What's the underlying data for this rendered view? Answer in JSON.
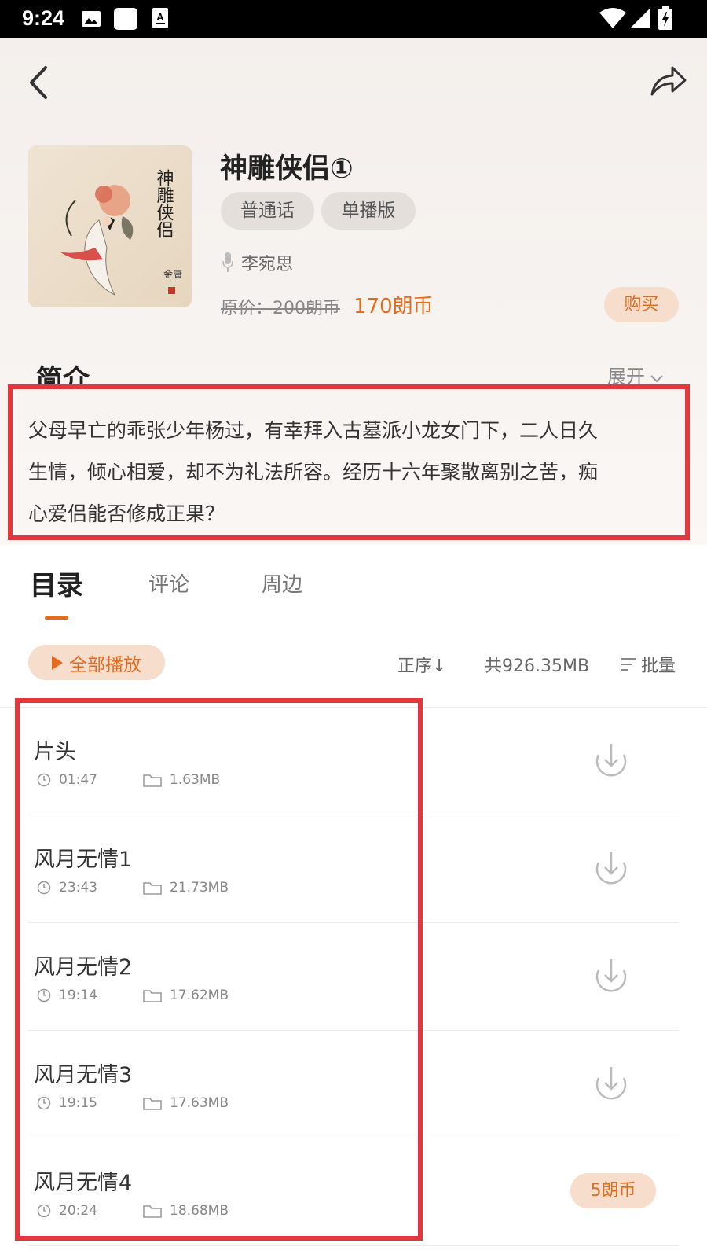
{
  "status_bar": {
    "time": "9:24",
    "left_icons": [
      "image-icon",
      "blank-notification-icon",
      "text-a-icon"
    ],
    "right_icons": [
      "wifi-icon",
      "signal-icon",
      "battery-icon"
    ]
  },
  "header": {
    "back_icon": "chevron-left-icon",
    "share_icon": "share-icon"
  },
  "book": {
    "cover_calligraphy": "神雕侠侣",
    "title": "神雕侠侣①",
    "tags": [
      "普通话",
      "单播版"
    ],
    "narrator": "李宛思",
    "price_original": "原价：200朗币",
    "price_current": "170朗币",
    "buy_label": "购买"
  },
  "intro": {
    "heading": "简介",
    "expand_label": "展开",
    "lines": [
      "父母早亡的乖张少年杨过，有幸拜入古墓派小龙女门下，二人日久",
      "生情，倾心相爱，却不为礼法所容。经历十六年聚散离别之苦，痴",
      "心爱侣能否修成正果？"
    ]
  },
  "tabs": [
    "目录",
    "评论",
    "周边"
  ],
  "active_tab": 0,
  "toolbar": {
    "play_all": "全部播放",
    "sort": "正序↓",
    "total_size": "共926.35MB",
    "batch": "批量"
  },
  "episodes": [
    {
      "title": "片头",
      "duration": "01:47",
      "size": "1.63MB",
      "action": "download"
    },
    {
      "title": "风月无情1",
      "duration": "23:43",
      "size": "21.73MB",
      "action": "download"
    },
    {
      "title": "风月无情2",
      "duration": "19:14",
      "size": "17.62MB",
      "action": "download"
    },
    {
      "title": "风月无情3",
      "duration": "19:15",
      "size": "17.63MB",
      "action": "download"
    },
    {
      "title": "风月无情4",
      "duration": "20:24",
      "size": "18.68MB",
      "action": "5朗币"
    }
  ],
  "colors": {
    "accent": "#e36c1e",
    "accent_bg": "#f6ddcc",
    "highlight_border": "#e0383d"
  }
}
